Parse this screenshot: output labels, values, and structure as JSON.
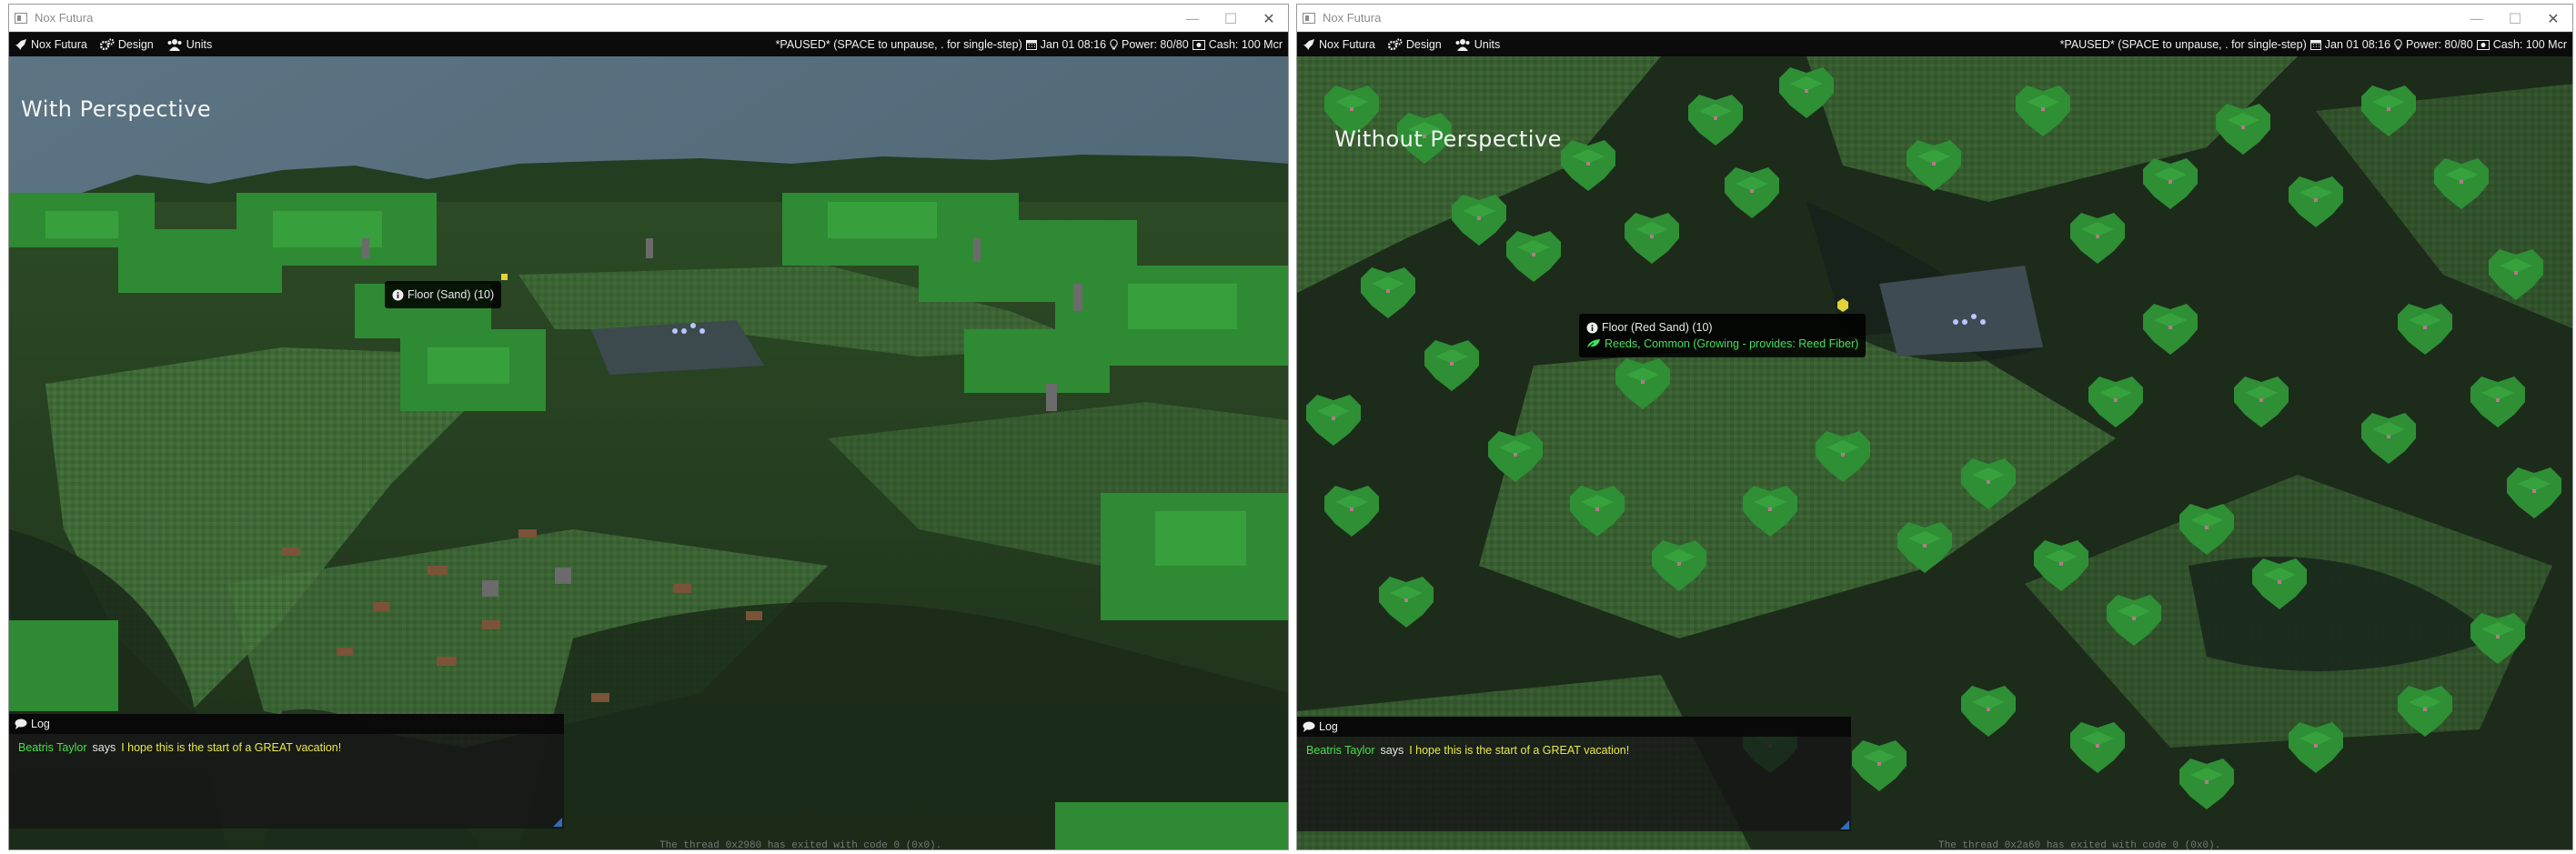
{
  "windows": [
    {
      "title": "Nox Futura",
      "menu": {
        "app": "Nox Futura",
        "design": "Design",
        "units": "Units"
      },
      "status": {
        "paused": "*PAUSED* (SPACE to unpause, . for single-step)",
        "date": "Jan 01 08:16",
        "power": "Power: 80/80",
        "cash": "Cash: 100 Mcr"
      },
      "overlay_title": "With Perspective",
      "tooltip": {
        "line1": "Floor (Sand) (10)",
        "line2": ""
      },
      "log": {
        "header": "Log",
        "speaker": "Beatris Taylor",
        "says": "says",
        "message": "I hope this is the start of a GREAT vacation!"
      },
      "console": "The thread 0x2980 has exited with code 0 (0x0)."
    },
    {
      "title": "Nox Futura",
      "menu": {
        "app": "Nox Futura",
        "design": "Design",
        "units": "Units"
      },
      "status": {
        "paused": "*PAUSED* (SPACE to unpause, . for single-step)",
        "date": "Jan 01 08:16",
        "power": "Power: 80/80",
        "cash": "Cash: 100 Mcr"
      },
      "overlay_title": "Without Perspective",
      "tooltip": {
        "line1": "Floor (Red Sand) (10)",
        "line2": "Reeds, Common (Growing - provides: Reed Fiber)"
      },
      "log": {
        "header": "Log",
        "speaker": "Beatris Taylor",
        "says": "says",
        "message": "I hope this is the start of a GREAT vacation!"
      },
      "console": "The thread 0x2a60 has exited with code 0 (0x0)."
    }
  ],
  "colors": {
    "menubar_bg": "#0b0b0b",
    "speaker_green": "#48e04a",
    "message_yellow": "#e9e94a",
    "tooltip_green": "#43e05a",
    "tree_green": "#2e8f35",
    "grass": "#3f6b30",
    "shadow": "#1d2b1b",
    "sky_top": "#5a7282",
    "sky_horizon": "#8fa6b0"
  },
  "icons": {
    "app": "rocket-icon",
    "design": "gears-icon",
    "units": "users-icon",
    "date": "calendar-icon",
    "power": "lightbulb-icon",
    "cash": "money-icon",
    "tooltip": "info-icon",
    "plant": "leaf-icon",
    "log": "comment-icon"
  }
}
